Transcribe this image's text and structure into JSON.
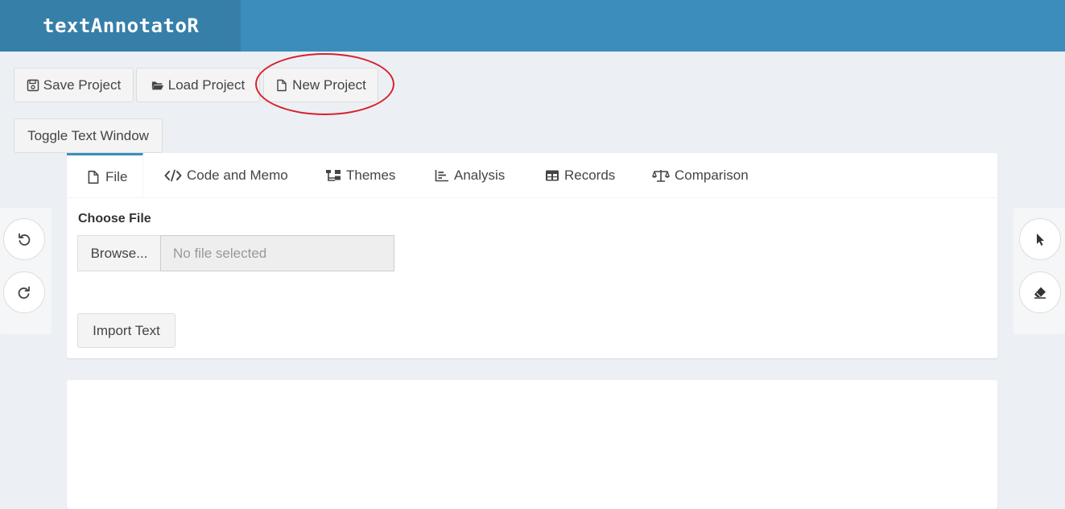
{
  "app": {
    "brand": "textAnnotatoR"
  },
  "toolbar": {
    "save_label": "Save Project",
    "load_label": "Load Project",
    "new_label": "New Project",
    "toggle_label": "Toggle Text Window"
  },
  "tabs": [
    {
      "label": "File",
      "icon": "file-icon",
      "active": true
    },
    {
      "label": "Code and Memo",
      "icon": "code-icon"
    },
    {
      "label": "Themes",
      "icon": "sitemap-icon"
    },
    {
      "label": "Analysis",
      "icon": "chart-bar-icon"
    },
    {
      "label": "Records",
      "icon": "table-icon"
    },
    {
      "label": "Comparison",
      "icon": "balance-scale-icon"
    }
  ],
  "file_tab": {
    "choose_label": "Choose File",
    "browse_label": "Browse...",
    "file_placeholder": "No file selected",
    "import_label": "Import Text"
  },
  "colors": {
    "header": "#3c8dbc",
    "brand_bg": "#367fa9",
    "highlight": "#d9202a"
  }
}
